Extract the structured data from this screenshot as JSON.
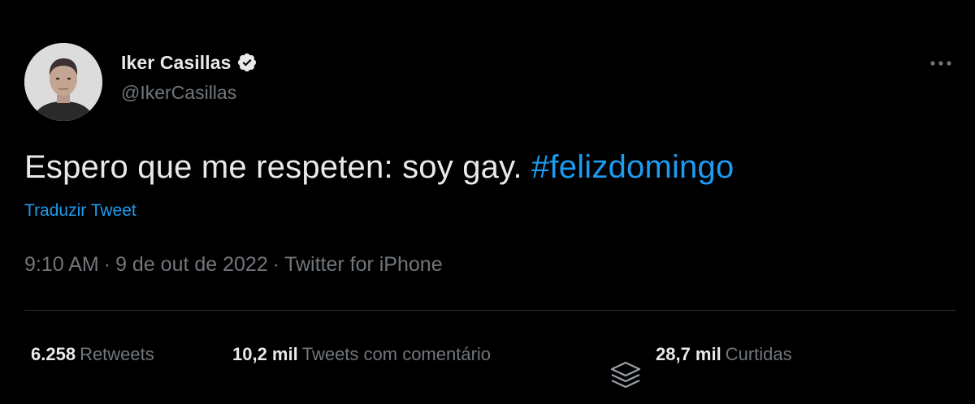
{
  "tweet": {
    "author": {
      "display_name": "Iker Casillas",
      "handle": "@IkerCasillas",
      "verified": true,
      "avatar_icon": "profile-photo"
    },
    "text": "Espero que me respeten: soy gay. ",
    "hashtag": "#felizdomingo",
    "translate_label": "Traduzir Tweet",
    "time": "9:10 AM",
    "date": "9 de out de 2022",
    "separator": "·",
    "source": "Twitter for iPhone",
    "stats": {
      "retweets_count": "6.258",
      "retweets_label": "Retweets",
      "quotes_count": "10,2 mil",
      "quotes_label": "Tweets com comentário",
      "likes_count": "28,7 mil",
      "likes_label": "Curtidas"
    }
  },
  "colors": {
    "background": "#000000",
    "text_primary": "#e7e9ea",
    "text_secondary": "#71767b",
    "accent": "#1d9bf0",
    "divider": "#2f3336"
  },
  "icons": {
    "verified": "verified-badge-icon",
    "more": "more-options-icon",
    "layers": "layers-icon"
  }
}
